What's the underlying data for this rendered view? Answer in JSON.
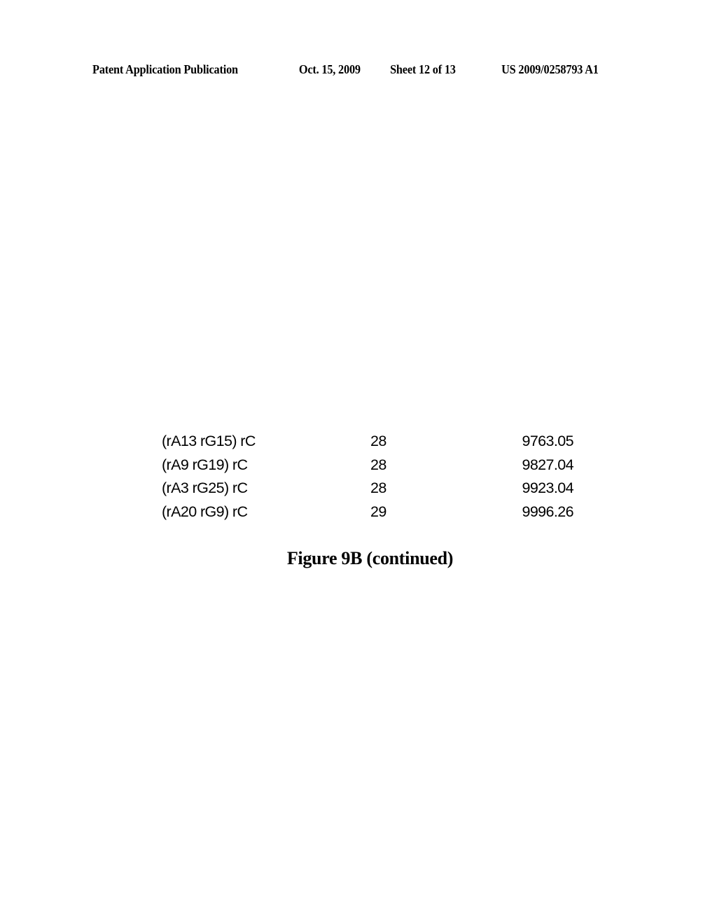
{
  "header": {
    "publication": "Patent Application Publication",
    "date": "Oct. 15, 2009",
    "sheet": "Sheet 12 of 13",
    "number": "US 2009/0258793 A1"
  },
  "table": {
    "rows": [
      {
        "name": "(rA13 rG15) rC",
        "length": "28",
        "mass": "9763.05"
      },
      {
        "name": "(rA9 rG19) rC",
        "length": "28",
        "mass": "9827.04"
      },
      {
        "name": "(rA3 rG25) rC",
        "length": "28",
        "mass": "9923.04"
      },
      {
        "name": "(rA20 rG9) rC",
        "length": "29",
        "mass": "9996.26"
      }
    ]
  },
  "caption": "Figure 9B (continued)"
}
